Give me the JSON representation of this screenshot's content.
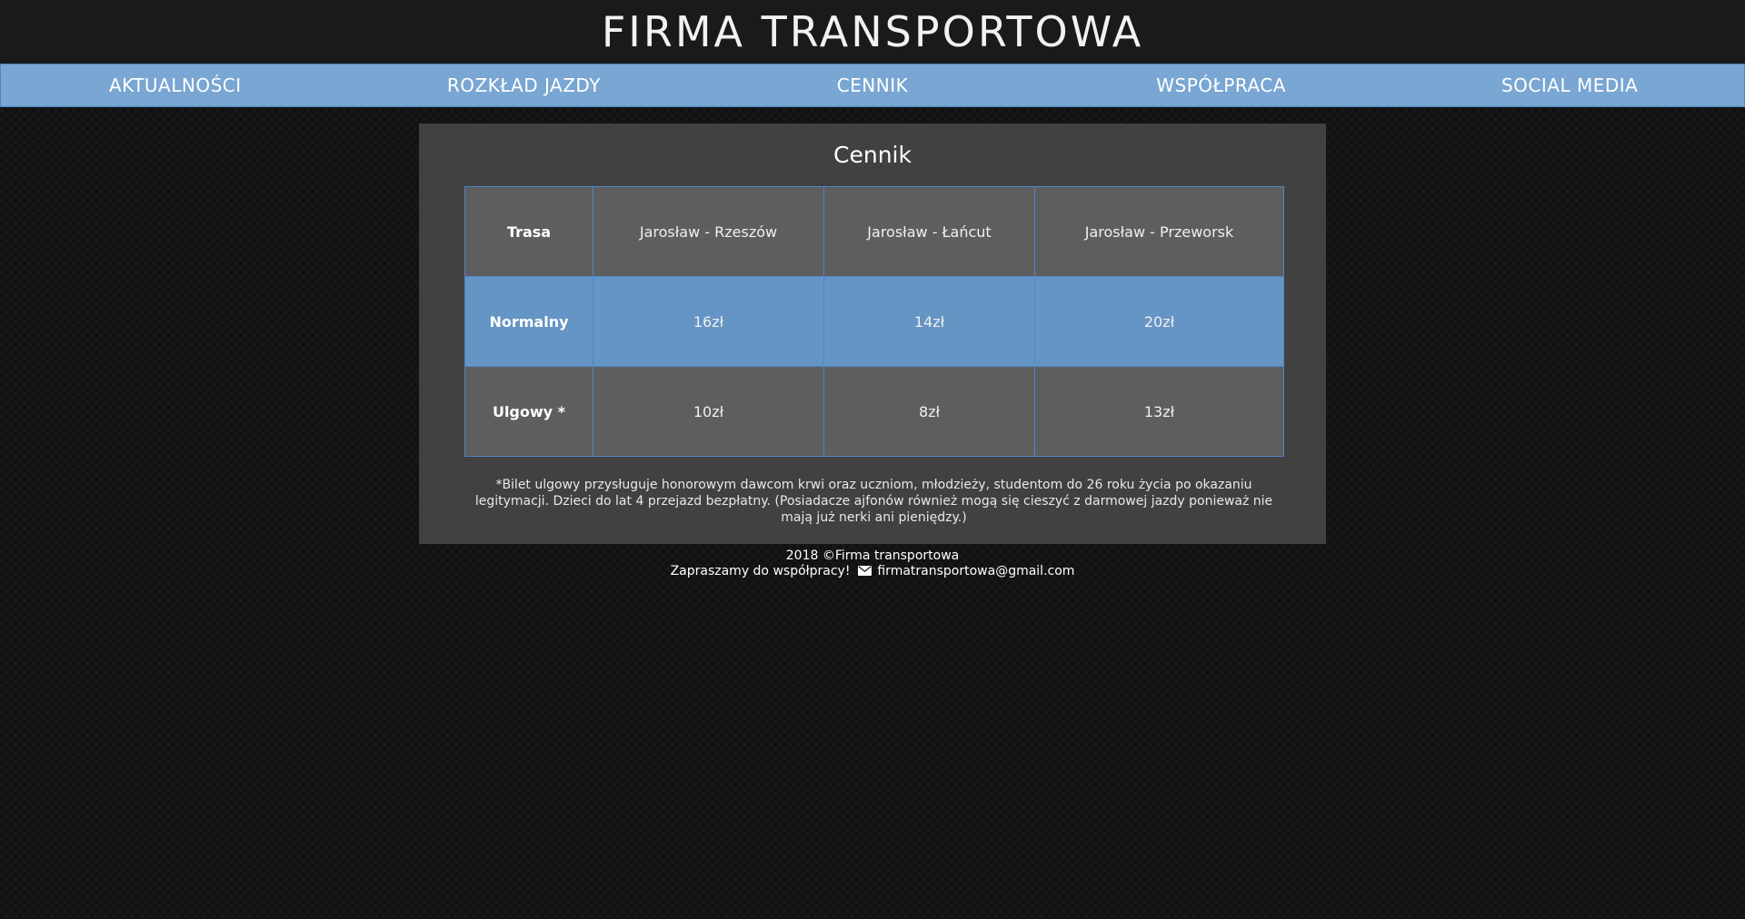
{
  "site": {
    "title": "FIRMA TRANSPORTOWA"
  },
  "nav": {
    "items": [
      {
        "label": "AKTUALNOŚCI"
      },
      {
        "label": "ROZKŁAD JAZDY"
      },
      {
        "label": "CENNIK"
      },
      {
        "label": "WSPÓŁPRACA"
      },
      {
        "label": "SOCIAL MEDIA"
      }
    ]
  },
  "pricing": {
    "title": "Cennik",
    "table": {
      "header": {
        "label": "Trasa",
        "routes": [
          "Jarosław - Rzeszów",
          "Jarosław - Łańcut",
          "Jarosław - Przeworsk"
        ]
      },
      "rows": [
        {
          "label": "Normalny",
          "prices": [
            "16zł",
            "14zł",
            "20zł"
          ]
        },
        {
          "label": "Ulgowy *",
          "prices": [
            "10zł",
            "8zł",
            "13zł"
          ]
        }
      ]
    },
    "footnote": "*Bilet ulgowy przysługuje honorowym dawcom krwi oraz uczniom, młodzieży, studentom do 26 roku życia po okazaniu legitymacji. Dzieci do lat 4 przejazd bezpłatny. (Posiadacze ajfonów również mogą się cieszyć z darmowej jazdy ponieważ nie mają już nerki ani pieniędzy.)"
  },
  "footer": {
    "copyright": "2018 ©Firma transportowa",
    "invite": "Zapraszamy do współpracy!",
    "email": "firmatransportowa@gmail.com",
    "email_icon": "envelope-icon"
  },
  "colors": {
    "nav_bg": "#79a6d2",
    "accent_border": "#4f86c6",
    "table_gray": "#5e5e5e",
    "table_blue": "#6595c4",
    "panel_bg": "#414141",
    "header_bg": "#1a1a1a"
  }
}
